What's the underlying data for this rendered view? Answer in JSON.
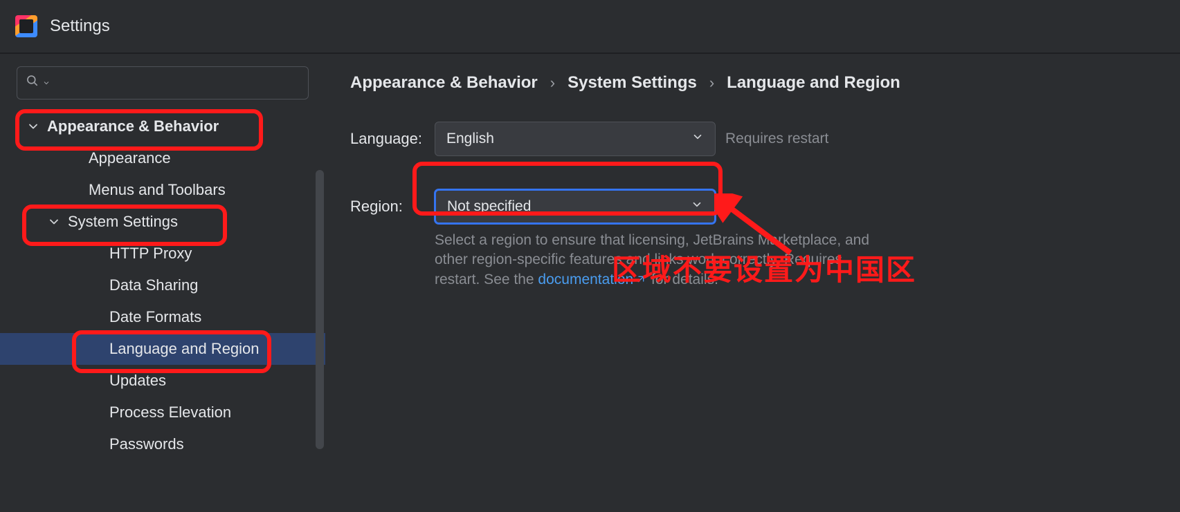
{
  "window": {
    "title": "Settings"
  },
  "breadcrumb": {
    "a": "Appearance & Behavior",
    "b": "System Settings",
    "c": "Language and Region"
  },
  "sidebar": {
    "search_placeholder": "",
    "items": [
      {
        "label": "Appearance & Behavior",
        "kind": "top",
        "expanded": true
      },
      {
        "label": "Appearance",
        "kind": "child"
      },
      {
        "label": "Menus and Toolbars",
        "kind": "child"
      },
      {
        "label": "System Settings",
        "kind": "child-expandable",
        "expanded": true
      },
      {
        "label": "HTTP Proxy",
        "kind": "grandchild"
      },
      {
        "label": "Data Sharing",
        "kind": "grandchild"
      },
      {
        "label": "Date Formats",
        "kind": "grandchild"
      },
      {
        "label": "Language and Region",
        "kind": "grandchild",
        "selected": true
      },
      {
        "label": "Updates",
        "kind": "grandchild"
      },
      {
        "label": "Process Elevation",
        "kind": "grandchild"
      },
      {
        "label": "Passwords",
        "kind": "grandchild"
      }
    ]
  },
  "form": {
    "language_label": "Language:",
    "language_value": "English",
    "language_hint": "Requires restart",
    "region_label": "Region:",
    "region_value": "Not specified",
    "region_desc_1": "Select a region to ensure that licensing, JetBrains Marketplace, and other region-specific features and links work correctly. Requires restart. See the ",
    "region_desc_link": "documentation",
    "region_desc_2": " for details."
  },
  "annotation": {
    "text": "区域不要设置为中国区"
  }
}
